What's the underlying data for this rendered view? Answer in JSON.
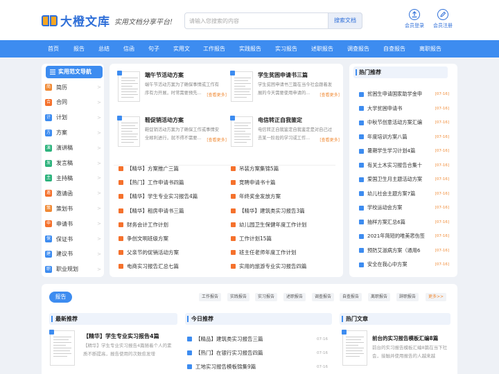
{
  "header": {
    "logo_text": "大橙文库",
    "slogan": "实用文档分享平台!",
    "search_placeholder": "请输入您搜索的内容",
    "search_button": "搜索文档",
    "login": "会员登录",
    "register": "会员注册"
  },
  "nav": [
    "首页",
    "报告",
    "总结",
    "信函",
    "句子",
    "实用文",
    "工作报告",
    "实践报告",
    "实习报告",
    "述职报告",
    "调查报告",
    "自查报告",
    "离职报告"
  ],
  "sidebar": {
    "title": "实用范文导航",
    "items": [
      {
        "label": "简历",
        "color": "#f08a35",
        "glyph": "简"
      },
      {
        "label": "合同",
        "color": "#f5712c",
        "glyph": "合"
      },
      {
        "label": "计划",
        "color": "#3d8cf0",
        "glyph": "计"
      },
      {
        "label": "方案",
        "color": "#3d8cf0",
        "glyph": "方"
      },
      {
        "label": "演讲稿",
        "color": "#2db37d",
        "glyph": "演"
      },
      {
        "label": "发言稿",
        "color": "#2db37d",
        "glyph": "发"
      },
      {
        "label": "主持稿",
        "color": "#2db37d",
        "glyph": "主"
      },
      {
        "label": "邀请函",
        "color": "#f5712c",
        "glyph": "邀"
      },
      {
        "label": "策划书",
        "color": "#f08a35",
        "glyph": "策"
      },
      {
        "label": "申请书",
        "color": "#f5712c",
        "glyph": "申"
      },
      {
        "label": "保证书",
        "color": "#3d8cf0",
        "glyph": "保"
      },
      {
        "label": "建议书",
        "color": "#3d8cf0",
        "glyph": "建"
      },
      {
        "label": "职业规划",
        "color": "#3d8cf0",
        "glyph": "职"
      }
    ],
    "arrow": ">"
  },
  "featured": [
    {
      "title": "端午节活动方案",
      "desc": "端午节活动方案为了确保事情或工作有序有力开展，时常需要预先...",
      "more": "[查看更多]"
    },
    {
      "title": "学生贫困申请书三篇",
      "desc": "学生贫困申请书三篇在当今社会跟着发展的今天需要使用申请的...",
      "more": "[查看更多]"
    },
    {
      "title": "鞋促销活动方案",
      "desc": "鞋促销活动方案为了确保工作或事情安全顺利进行，就不得不需要...",
      "more": "[查看更多]"
    },
    {
      "title": "电信转正自我鉴定",
      "desc": "电信转正自我鉴定自我鉴定是对自己过去某一阶段的学习或工作...",
      "more": "[查看更多]"
    }
  ],
  "list_left": [
    "【精华】方案推广三篇",
    "【热门】工作申请书四篇",
    "【精华】学生专业实习报告4篇",
    "【精华】租房申请书三篇",
    "财务会计工作计划",
    "争创文明班级方案",
    "父亲节的促销活动方案",
    "电商实习报告汇总七篇"
  ],
  "list_right": [
    "吊装方案集锦5篇",
    "竞聘申请书十篇",
    "年终奖金发放方案",
    "【精华】建筑类实习报告3篇",
    "幼儿园卫生保健年度工作计划",
    "工作计划15篇",
    "班主任老师年度工作计划",
    "实用的旅游专业实习报告四篇"
  ],
  "hot": {
    "title": "热门推荐",
    "items": [
      {
        "label": "贫困生申请国家助学金申",
        "date": "[07-16]"
      },
      {
        "label": "大学贫困申请书",
        "date": "[07-16]"
      },
      {
        "label": "中秋节创意活动方案汇编",
        "date": "[07-16]"
      },
      {
        "label": "年度培训方案八篇",
        "date": "[07-16]"
      },
      {
        "label": "暑期学生学习计划4篇",
        "date": "[07-16]"
      },
      {
        "label": "有关土木实习报告合集十",
        "date": "[07-16]"
      },
      {
        "label": "爱国卫生月主题活动方案",
        "date": "[07-16]"
      },
      {
        "label": "幼儿社会主题方案7篇",
        "date": "[07-16]"
      },
      {
        "label": "学校运动会方案",
        "date": "[07-16]"
      },
      {
        "label": "抽样方案汇总6篇",
        "date": "[07-16]"
      },
      {
        "label": "2021年简短的唯美悲伤签",
        "date": "[07-16]"
      },
      {
        "label": "预防艾滋病方案（通用6",
        "date": "[07-16]"
      },
      {
        "label": "安全在我心中方案",
        "date": "[07-16]"
      }
    ]
  },
  "report": {
    "tag": "报告",
    "tabs": [
      "工作报告",
      "实践报告",
      "实习报告",
      "述职报告",
      "调查报告",
      "自查报告",
      "离职报告",
      "辞职报告"
    ],
    "more": "更多>>",
    "latest": {
      "title": "最新推荐",
      "item_title": "【精华】学生专业实习报告4篇",
      "item_desc": "【精华】学生专业实习报告4篇随着个人的素质不断提高，报告使用的次数愈发增"
    },
    "today": {
      "title": "今日推荐",
      "items": [
        {
          "label": "【精品】建筑类实习报告三篇",
          "date": "07-16"
        },
        {
          "label": "【热门】在银行实习报告四篇",
          "date": "07-16"
        },
        {
          "label": "工地实习报告模板锦集9篇",
          "date": "07-16"
        }
      ]
    },
    "hot_article": {
      "title": "热门文章",
      "item_title": "前台的实习报告模板汇编8篇",
      "item_desc": "前台的实习报告模板汇编8篇在当下社会，接触并使用报告的人越来越"
    }
  }
}
